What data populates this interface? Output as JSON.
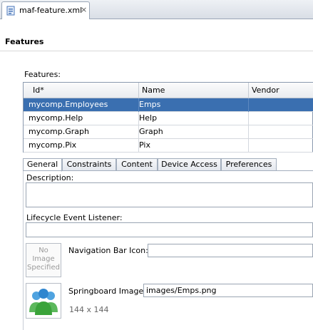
{
  "editor_tab": {
    "file_name": "maf-feature.xml",
    "close_glyph": "×",
    "icon": "xml-file-icon"
  },
  "page_title": "Features",
  "features": {
    "label": "Features:",
    "columns": [
      "Id*",
      "Name",
      "Vendor"
    ],
    "rows": [
      {
        "id": "mycomp.Employees",
        "name": "Emps",
        "vendor": "",
        "selected": true
      },
      {
        "id": "mycomp.Help",
        "name": "Help",
        "vendor": ""
      },
      {
        "id": "mycomp.Graph",
        "name": "Graph",
        "vendor": ""
      },
      {
        "id": "mycomp.Pix",
        "name": "Pix",
        "vendor": ""
      }
    ],
    "selection_color": "#3a6fb0"
  },
  "tabs": [
    "General",
    "Constraints",
    "Content",
    "Device Access",
    "Preferences"
  ],
  "active_tab": "General",
  "general": {
    "description_label": "Description:",
    "description_value": "",
    "lifecycle_label": "Lifecycle Event Listener:",
    "lifecycle_value": "",
    "nav_icon_placeholder": [
      "No",
      "Image",
      "Specified"
    ],
    "nav_bar_icon_label": "Navigation Bar Icon:",
    "nav_bar_icon_value": "",
    "springboard_label": "Springboard Image:",
    "springboard_value": "images/Emps.png",
    "springboard_size": "144 x 144"
  }
}
